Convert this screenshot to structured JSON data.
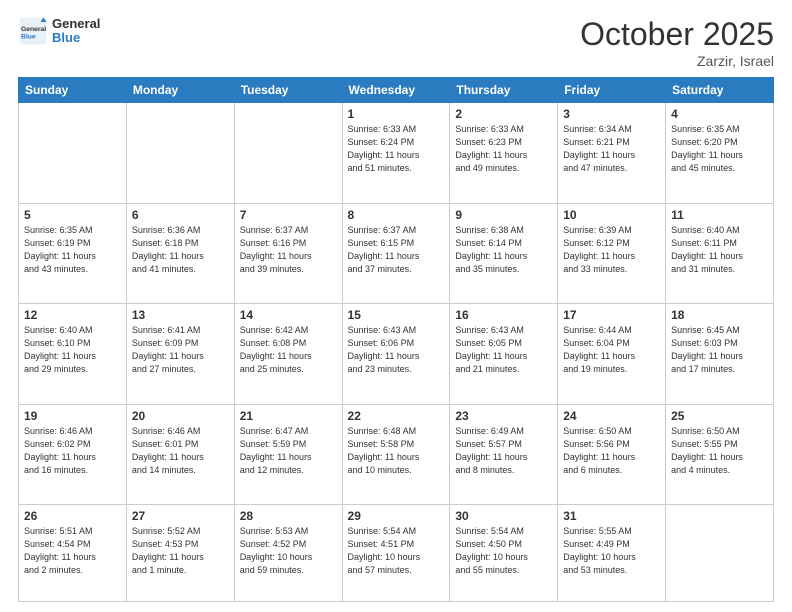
{
  "header": {
    "logo_general": "General",
    "logo_blue": "Blue",
    "month_title": "October 2025",
    "location": "Zarzir, Israel"
  },
  "weekdays": [
    "Sunday",
    "Monday",
    "Tuesday",
    "Wednesday",
    "Thursday",
    "Friday",
    "Saturday"
  ],
  "weeks": [
    [
      {
        "day": "",
        "info": ""
      },
      {
        "day": "",
        "info": ""
      },
      {
        "day": "",
        "info": ""
      },
      {
        "day": "1",
        "info": "Sunrise: 6:33 AM\nSunset: 6:24 PM\nDaylight: 11 hours\nand 51 minutes."
      },
      {
        "day": "2",
        "info": "Sunrise: 6:33 AM\nSunset: 6:23 PM\nDaylight: 11 hours\nand 49 minutes."
      },
      {
        "day": "3",
        "info": "Sunrise: 6:34 AM\nSunset: 6:21 PM\nDaylight: 11 hours\nand 47 minutes."
      },
      {
        "day": "4",
        "info": "Sunrise: 6:35 AM\nSunset: 6:20 PM\nDaylight: 11 hours\nand 45 minutes."
      }
    ],
    [
      {
        "day": "5",
        "info": "Sunrise: 6:35 AM\nSunset: 6:19 PM\nDaylight: 11 hours\nand 43 minutes."
      },
      {
        "day": "6",
        "info": "Sunrise: 6:36 AM\nSunset: 6:18 PM\nDaylight: 11 hours\nand 41 minutes."
      },
      {
        "day": "7",
        "info": "Sunrise: 6:37 AM\nSunset: 6:16 PM\nDaylight: 11 hours\nand 39 minutes."
      },
      {
        "day": "8",
        "info": "Sunrise: 6:37 AM\nSunset: 6:15 PM\nDaylight: 11 hours\nand 37 minutes."
      },
      {
        "day": "9",
        "info": "Sunrise: 6:38 AM\nSunset: 6:14 PM\nDaylight: 11 hours\nand 35 minutes."
      },
      {
        "day": "10",
        "info": "Sunrise: 6:39 AM\nSunset: 6:12 PM\nDaylight: 11 hours\nand 33 minutes."
      },
      {
        "day": "11",
        "info": "Sunrise: 6:40 AM\nSunset: 6:11 PM\nDaylight: 11 hours\nand 31 minutes."
      }
    ],
    [
      {
        "day": "12",
        "info": "Sunrise: 6:40 AM\nSunset: 6:10 PM\nDaylight: 11 hours\nand 29 minutes."
      },
      {
        "day": "13",
        "info": "Sunrise: 6:41 AM\nSunset: 6:09 PM\nDaylight: 11 hours\nand 27 minutes."
      },
      {
        "day": "14",
        "info": "Sunrise: 6:42 AM\nSunset: 6:08 PM\nDaylight: 11 hours\nand 25 minutes."
      },
      {
        "day": "15",
        "info": "Sunrise: 6:43 AM\nSunset: 6:06 PM\nDaylight: 11 hours\nand 23 minutes."
      },
      {
        "day": "16",
        "info": "Sunrise: 6:43 AM\nSunset: 6:05 PM\nDaylight: 11 hours\nand 21 minutes."
      },
      {
        "day": "17",
        "info": "Sunrise: 6:44 AM\nSunset: 6:04 PM\nDaylight: 11 hours\nand 19 minutes."
      },
      {
        "day": "18",
        "info": "Sunrise: 6:45 AM\nSunset: 6:03 PM\nDaylight: 11 hours\nand 17 minutes."
      }
    ],
    [
      {
        "day": "19",
        "info": "Sunrise: 6:46 AM\nSunset: 6:02 PM\nDaylight: 11 hours\nand 16 minutes."
      },
      {
        "day": "20",
        "info": "Sunrise: 6:46 AM\nSunset: 6:01 PM\nDaylight: 11 hours\nand 14 minutes."
      },
      {
        "day": "21",
        "info": "Sunrise: 6:47 AM\nSunset: 5:59 PM\nDaylight: 11 hours\nand 12 minutes."
      },
      {
        "day": "22",
        "info": "Sunrise: 6:48 AM\nSunset: 5:58 PM\nDaylight: 11 hours\nand 10 minutes."
      },
      {
        "day": "23",
        "info": "Sunrise: 6:49 AM\nSunset: 5:57 PM\nDaylight: 11 hours\nand 8 minutes."
      },
      {
        "day": "24",
        "info": "Sunrise: 6:50 AM\nSunset: 5:56 PM\nDaylight: 11 hours\nand 6 minutes."
      },
      {
        "day": "25",
        "info": "Sunrise: 6:50 AM\nSunset: 5:55 PM\nDaylight: 11 hours\nand 4 minutes."
      }
    ],
    [
      {
        "day": "26",
        "info": "Sunrise: 5:51 AM\nSunset: 4:54 PM\nDaylight: 11 hours\nand 2 minutes."
      },
      {
        "day": "27",
        "info": "Sunrise: 5:52 AM\nSunset: 4:53 PM\nDaylight: 11 hours\nand 1 minute."
      },
      {
        "day": "28",
        "info": "Sunrise: 5:53 AM\nSunset: 4:52 PM\nDaylight: 10 hours\nand 59 minutes."
      },
      {
        "day": "29",
        "info": "Sunrise: 5:54 AM\nSunset: 4:51 PM\nDaylight: 10 hours\nand 57 minutes."
      },
      {
        "day": "30",
        "info": "Sunrise: 5:54 AM\nSunset: 4:50 PM\nDaylight: 10 hours\nand 55 minutes."
      },
      {
        "day": "31",
        "info": "Sunrise: 5:55 AM\nSunset: 4:49 PM\nDaylight: 10 hours\nand 53 minutes."
      },
      {
        "day": "",
        "info": ""
      }
    ]
  ]
}
